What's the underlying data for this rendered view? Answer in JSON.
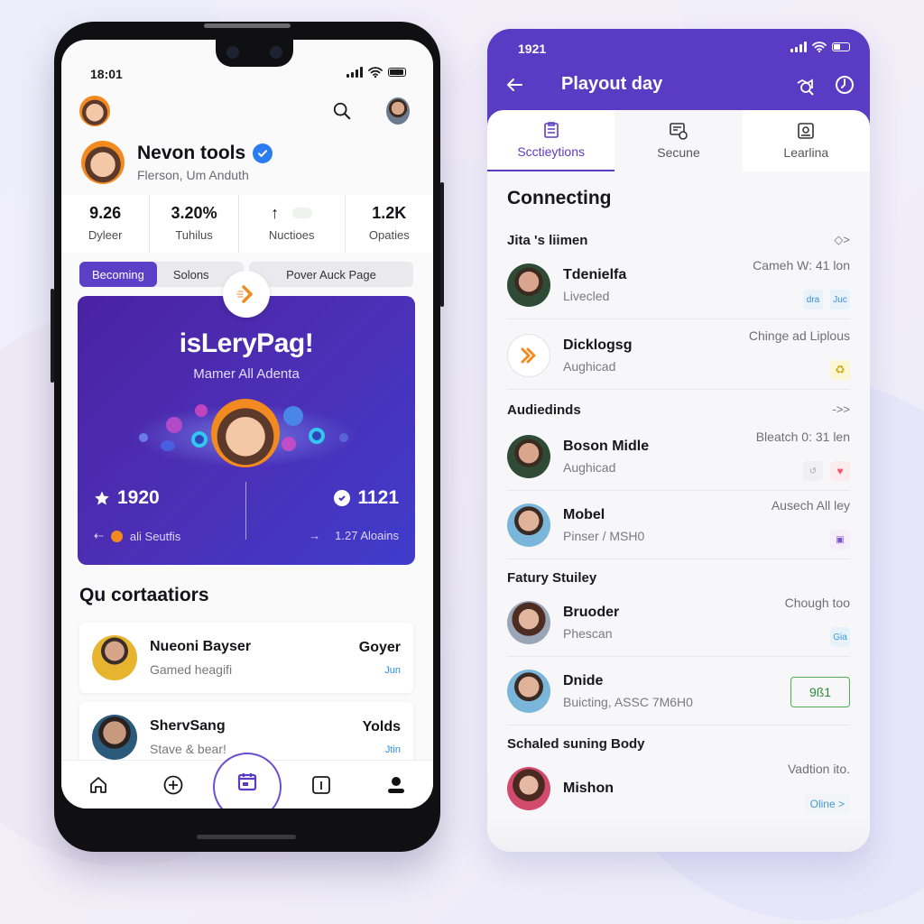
{
  "left_phone": {
    "status_time": "18:01",
    "header": {
      "search_icon": "search-icon",
      "avatar_icon": "user-avatar"
    },
    "profile": {
      "name": "Nevon tools",
      "verified": true,
      "subtitle": "Flerson, Um Anduth"
    },
    "stats": [
      {
        "value": "9.26",
        "label": "Dyleer"
      },
      {
        "value": "3.20%",
        "label": "Tuhilus"
      },
      {
        "value": "↑",
        "label": "Nuctioes"
      },
      {
        "value": "1.2K",
        "label": "Opaties"
      }
    ],
    "segments": {
      "active": "Becoming",
      "inactive": "Solons",
      "page_button": "Pover Auck Page"
    },
    "hero": {
      "title": "isLeryPag!",
      "subtitle": "Mamer All Adenta",
      "left_stat": "1920",
      "right_stat": "1121",
      "left_footer": "ali Seutfis",
      "right_footer": "1.27 Aloains"
    },
    "section_title": "Qu cortaatiors",
    "list": [
      {
        "name": "Nueoni Bayser",
        "subtitle": "Gamed heagifi",
        "right_top": "Goyer",
        "right_bottom": "Jun"
      },
      {
        "name": "ShervSang",
        "subtitle": "Stave & bear!",
        "right_top": "Yolds",
        "right_bottom": "Jtin"
      }
    ],
    "tabbar": [
      "home-icon",
      "add-circle-icon",
      "calendar-icon",
      "card-icon",
      "profile-icon"
    ]
  },
  "right_panel": {
    "status_time": "1921",
    "title": "Playout day",
    "tabs": [
      {
        "label": "Scctieytions",
        "active": true
      },
      {
        "label": "Secune",
        "active": false
      },
      {
        "label": "Learlina",
        "active": false
      }
    ],
    "heading": "Connecting",
    "groups": [
      {
        "title": "Jita 's liimen",
        "more": "◇>",
        "rows": [
          {
            "name": "Tdenielfa",
            "sub": "Livecled",
            "meta": "Cameh W: 41 lon",
            "chips": [
              "dra",
              "Juc"
            ]
          },
          {
            "name": "Dicklogsg",
            "sub": "Aughicad",
            "meta": "Chinge ad Liplous",
            "chips": [
              "♻"
            ]
          }
        ]
      },
      {
        "title": "Audiedinds",
        "more": "->>",
        "rows": [
          {
            "name": "Boson Midle",
            "sub": "Aughicad",
            "meta": "Bleatch 0: 31 len",
            "chips": [
              "↺",
              "♥"
            ]
          },
          {
            "name": "Mobel",
            "sub": "Pinser / MSH0",
            "meta": "Ausech All ley",
            "chips": [
              "▣"
            ]
          }
        ]
      },
      {
        "title": "Fatury Stuiley",
        "more": "",
        "rows": [
          {
            "name": "Bruoder",
            "sub": "Phescan",
            "meta": "Chough too",
            "chips": [
              "Gia"
            ]
          },
          {
            "name": "Dnide",
            "sub": "Buicting, ASSC 7M6H0",
            "meta": "",
            "badge": "9ß1"
          }
        ]
      },
      {
        "title": "Schaled suning Body",
        "more": "",
        "rows": [
          {
            "name": "Mishon",
            "sub": "",
            "meta": "Vadtion ito.",
            "status": "Oline >"
          }
        ]
      }
    ]
  },
  "colors": {
    "accent": "#5a3cc4",
    "hero_gradient_start": "#4a22a3",
    "hero_gradient_end": "#3f3ccc",
    "verified": "#2b7cf0",
    "orange": "#f28a1f",
    "success": "#4caf50",
    "link_blue": "#2b8ee0"
  }
}
